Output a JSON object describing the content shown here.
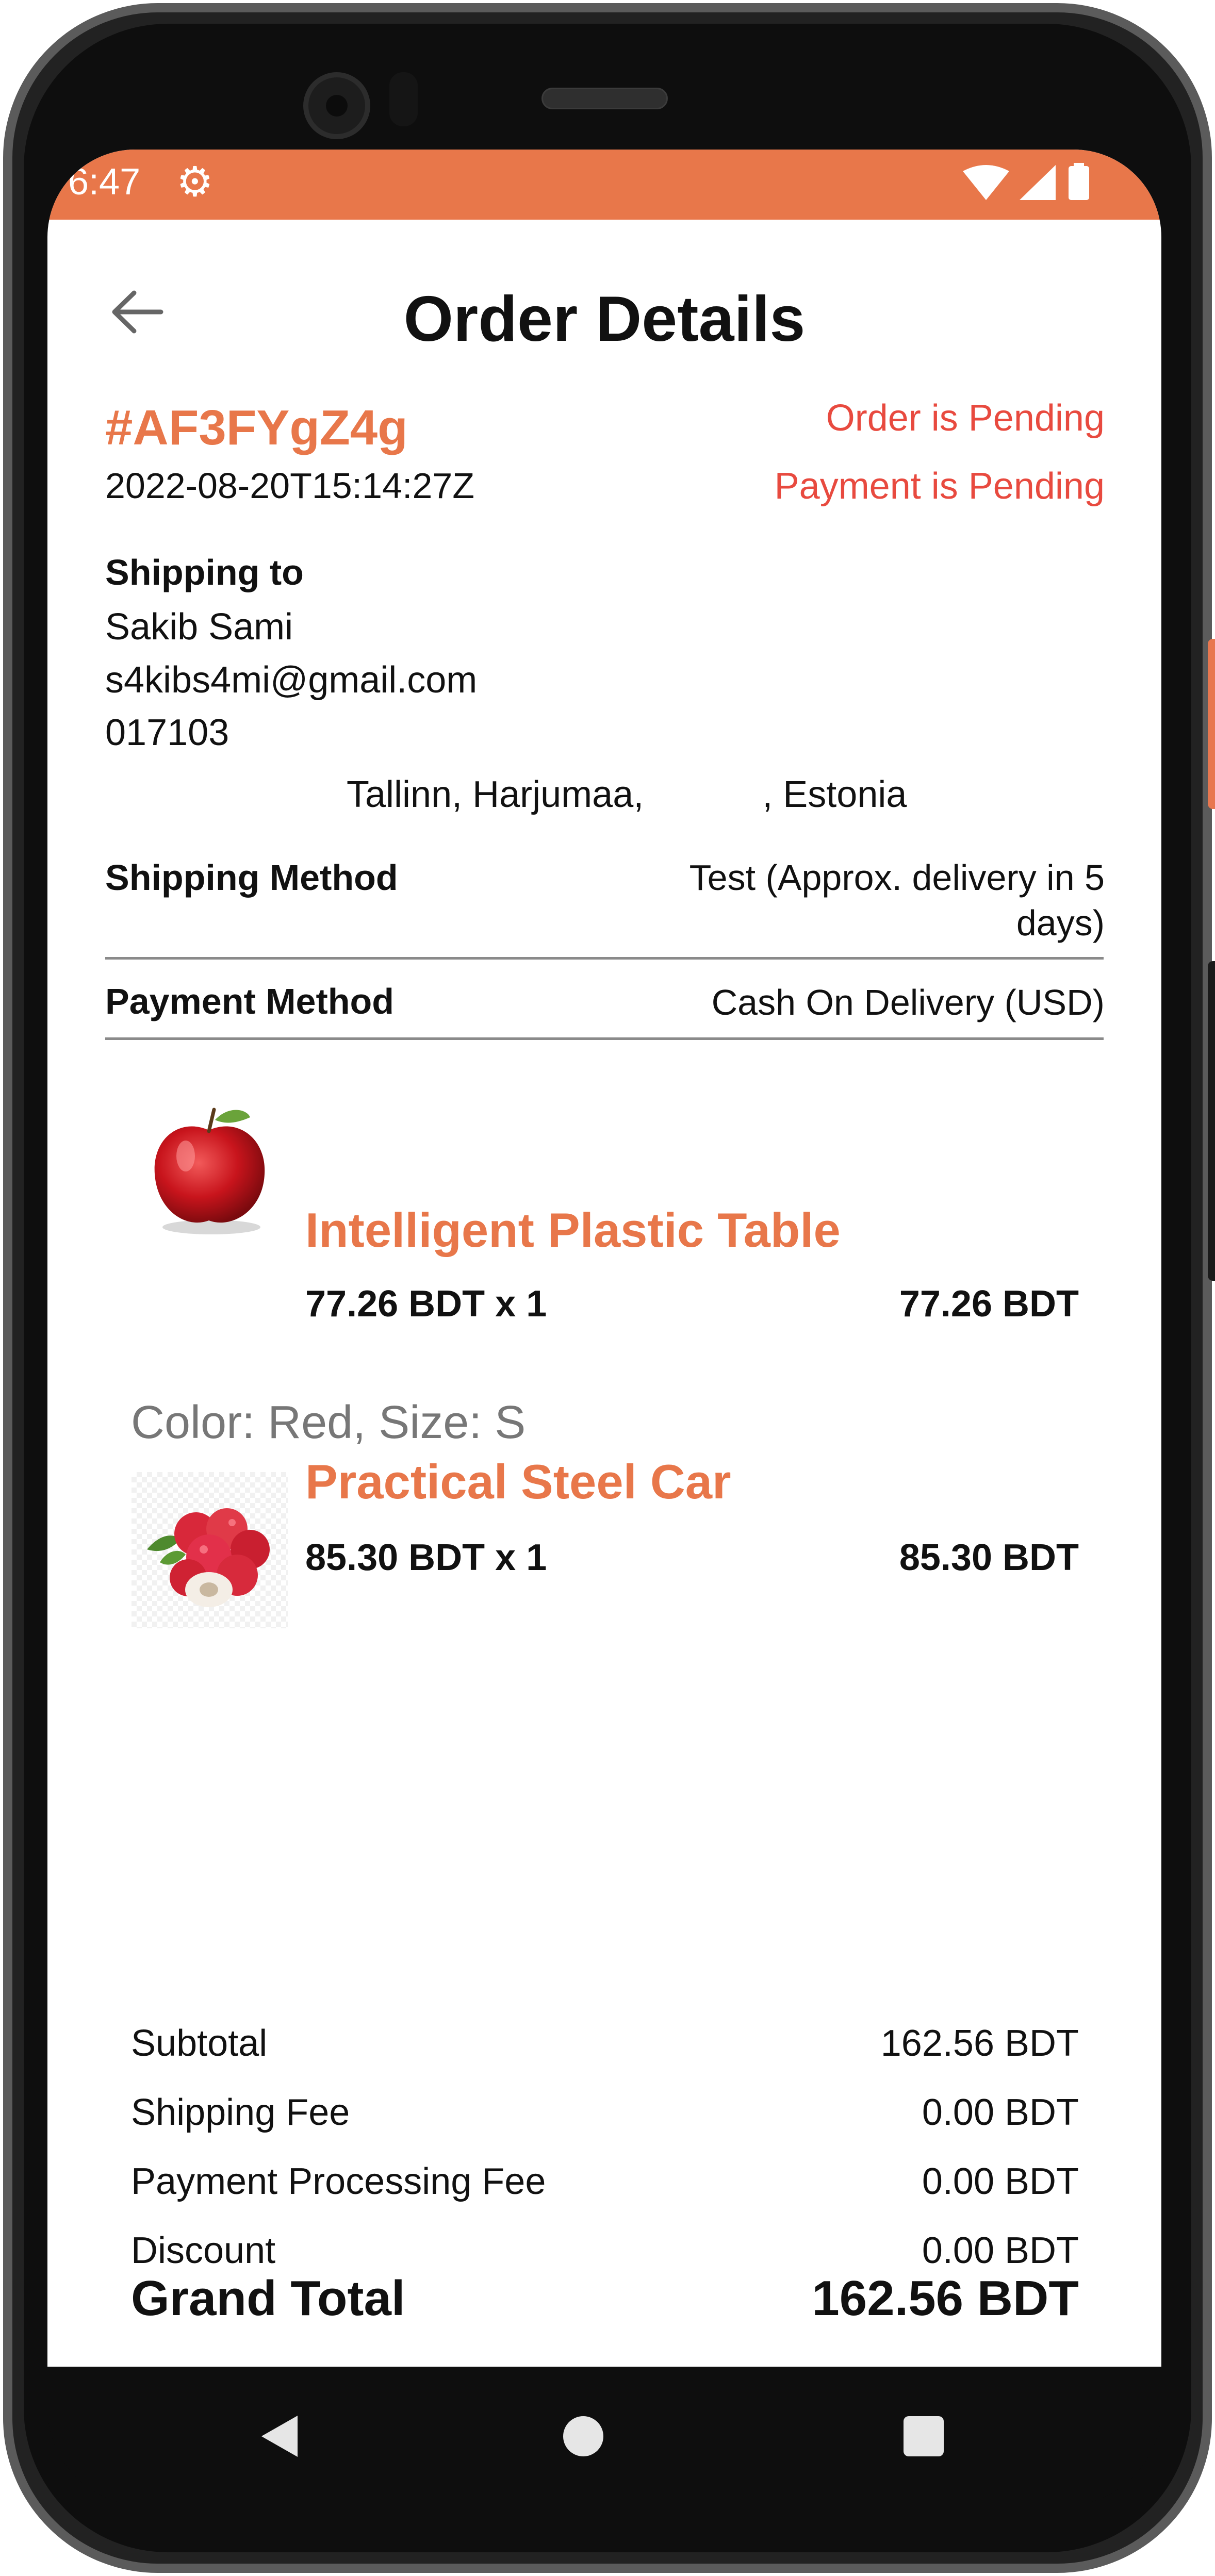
{
  "status_bar": {
    "time": "6:47",
    "icons": [
      "settings-gear-icon",
      "wifi-icon",
      "signal-icon",
      "battery-icon"
    ]
  },
  "header": {
    "title": "Order Details",
    "back_icon": "arrow-back-icon"
  },
  "order": {
    "id": "#AF3FYgZ4g",
    "date": "2022-08-20T15:14:27Z",
    "order_status": "Order is Pending",
    "payment_status": "Payment is Pending"
  },
  "shipping": {
    "heading": "Shipping to",
    "name": "Sakib Sami",
    "email": "s4kibs4mi@gmail.com",
    "phone": "017103",
    "address_part1": "Tallinn, Harjumaa,",
    "address_part2": ", Estonia"
  },
  "methods": {
    "shipping_label": "Shipping Method",
    "shipping_value_line1": "Test (Approx. delivery in 5",
    "shipping_value_line2": "days)",
    "payment_label": "Payment Method",
    "payment_value": "Cash On Delivery (USD)"
  },
  "items": [
    {
      "name": "Intelligent Plastic Table",
      "qty_line": "77.26 BDT x 1",
      "total": "77.26 BDT",
      "image": "red-apple-image",
      "variant": "Color: Red, Size: S"
    },
    {
      "name": "Practical Steel Car",
      "qty_line": "85.30 BDT x 1",
      "total": "85.30 BDT",
      "image": "lychee-fruit-image"
    }
  ],
  "summary": {
    "subtotal_label": "Subtotal",
    "subtotal_value": "162.56 BDT",
    "shipping_fee_label": "Shipping Fee",
    "shipping_fee_value": "0.00 BDT",
    "processing_fee_label": "Payment Processing Fee",
    "processing_fee_value": "0.00 BDT",
    "discount_label": "Discount",
    "discount_value": "0.00 BDT",
    "grand_total_label": "Grand Total",
    "grand_total_value": "162.56 BDT"
  },
  "nav_bar": {
    "icons": [
      "nav-back-icon",
      "nav-home-icon",
      "nav-recents-icon"
    ]
  },
  "colors": {
    "accent": "#e8774a",
    "status_red": "#e84a3f"
  }
}
